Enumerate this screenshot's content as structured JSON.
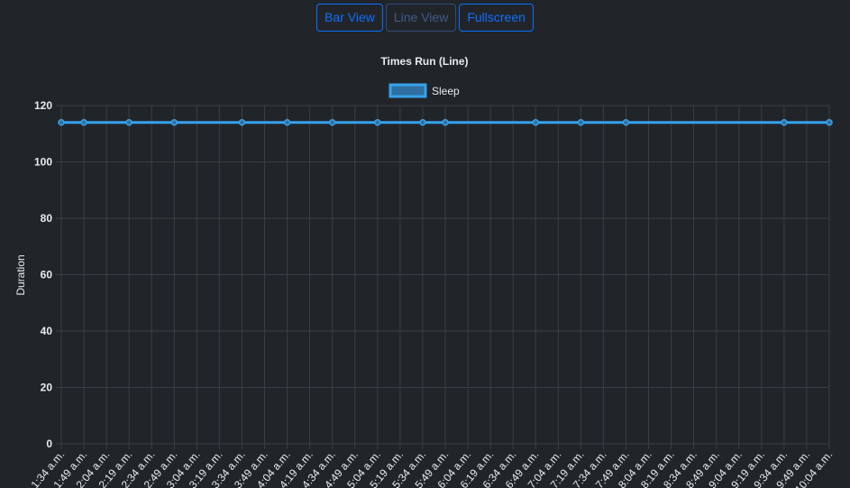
{
  "toolbar": {
    "bar_view_label": "Bar View",
    "line_view_label": "Line View",
    "fullscreen_label": "Fullscreen"
  },
  "colors": {
    "accent": "#0d6efd",
    "series_line": "#36a2eb",
    "background": "#212529",
    "grid": "#3a3f45"
  },
  "chart_data": {
    "type": "line",
    "title": "Times Run (Line)",
    "ylabel": "Duration",
    "xlabel": "",
    "ylim": [
      0,
      120
    ],
    "yticks": [
      0,
      20,
      40,
      60,
      80,
      100,
      120
    ],
    "grid": true,
    "legend_position": "top",
    "categories": [
      "1:34 a.m.",
      "1:49 a.m.",
      "2:04 a.m.",
      "2:19 a.m.",
      "2:34 a.m.",
      "2:49 a.m.",
      "3:04 a.m.",
      "3:19 a.m.",
      "3:34 a.m.",
      "3:49 a.m.",
      "4:04 a.m.",
      "4:19 a.m.",
      "4:34 a.m.",
      "4:49 a.m.",
      "5:04 a.m.",
      "5:19 a.m.",
      "5:34 a.m.",
      "5:49 a.m.",
      "6:04 a.m.",
      "6:19 a.m.",
      "6:34 a.m.",
      "6:49 a.m.",
      "7:04 a.m.",
      "7:19 a.m.",
      "7:34 a.m.",
      "7:49 a.m.",
      "8:04 a.m.",
      "8:19 a.m.",
      "8:34 a.m.",
      "8:49 a.m.",
      "9:04 a.m.",
      "9:19 a.m.",
      "9:34 a.m.",
      "9:49 a.m.",
      "10:04 a.m."
    ],
    "series": [
      {
        "name": "Sleep",
        "color": "#36a2eb",
        "points": [
          {
            "x": "1:34 a.m.",
            "y": 114
          },
          {
            "x": "1:49 a.m.",
            "y": 114
          },
          {
            "x": "2:19 a.m.",
            "y": 114
          },
          {
            "x": "2:49 a.m.",
            "y": 114
          },
          {
            "x": "3:34 a.m.",
            "y": 114
          },
          {
            "x": "4:04 a.m.",
            "y": 114
          },
          {
            "x": "4:34 a.m.",
            "y": 114
          },
          {
            "x": "5:04 a.m.",
            "y": 114
          },
          {
            "x": "5:34 a.m.",
            "y": 114
          },
          {
            "x": "5:49 a.m.",
            "y": 114
          },
          {
            "x": "6:49 a.m.",
            "y": 114
          },
          {
            "x": "7:19 a.m.",
            "y": 114
          },
          {
            "x": "7:49 a.m.",
            "y": 114
          },
          {
            "x": "9:34 a.m.",
            "y": 114
          },
          {
            "x": "10:04 a.m.",
            "y": 114
          }
        ]
      }
    ]
  }
}
